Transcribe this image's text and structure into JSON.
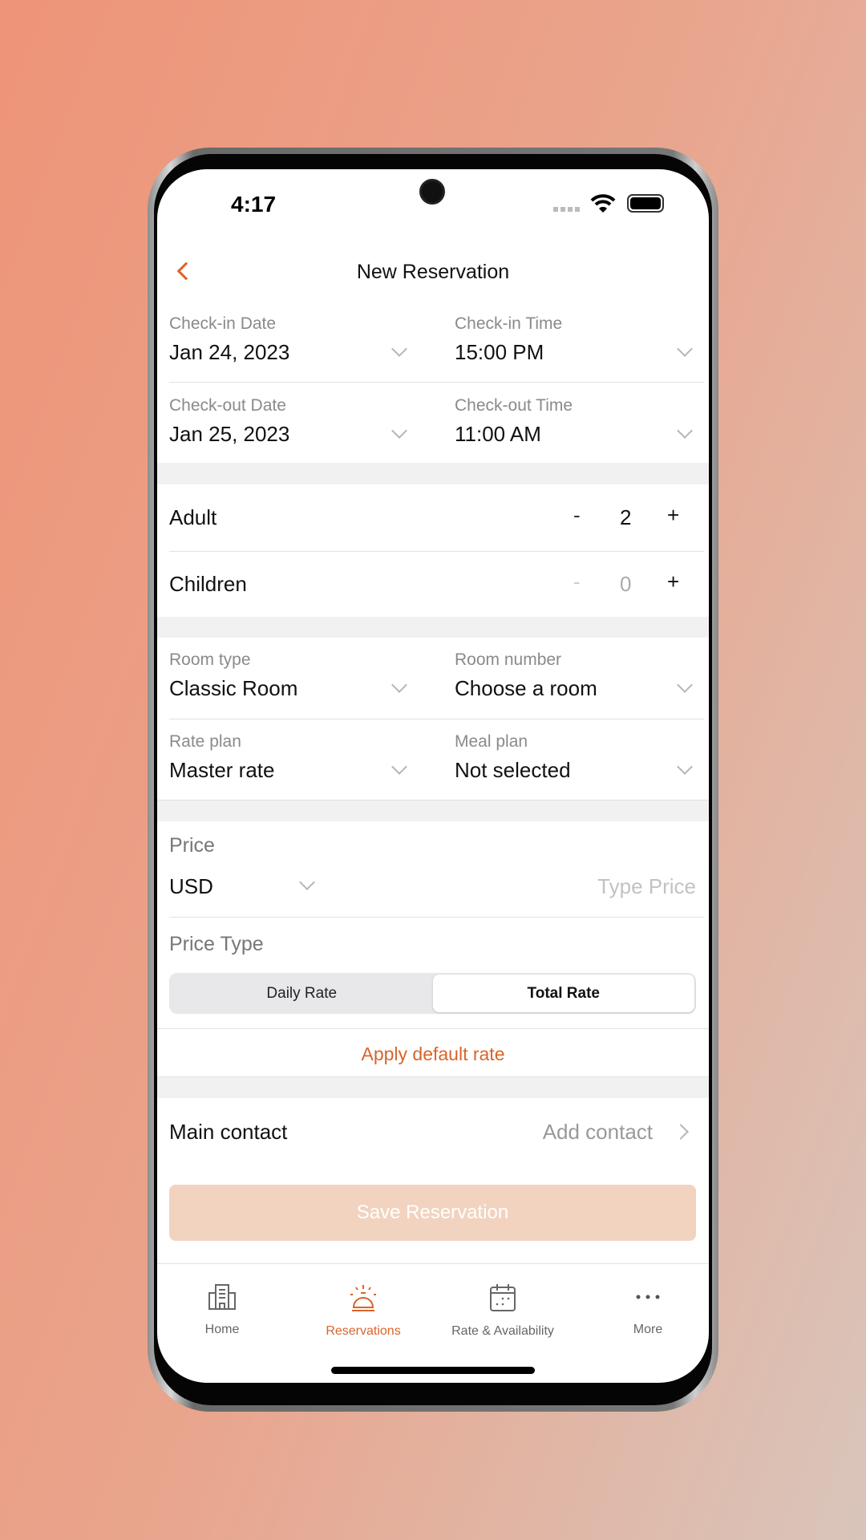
{
  "status_bar": {
    "time": "4:17"
  },
  "header": {
    "title": "New Reservation",
    "back_icon": "chevron-left-icon"
  },
  "dates": {
    "checkin_date_label": "Check-in Date",
    "checkin_date": "Jan 24, 2023",
    "checkin_time_label": "Check-in Time",
    "checkin_time": "15:00 PM",
    "checkout_date_label": "Check-out Date",
    "checkout_date": "Jan 25, 2023",
    "checkout_time_label": "Check-out Time",
    "checkout_time": "11:00 AM"
  },
  "guests": {
    "adult_label": "Adult",
    "adult_count": "2",
    "children_label": "Children",
    "children_count": "0",
    "minus": "-",
    "plus": "+"
  },
  "room": {
    "room_type_label": "Room type",
    "room_type": "Classic Room",
    "room_number_label": "Room number",
    "room_number": "Choose a room",
    "rate_plan_label": "Rate plan",
    "rate_plan": "Master rate",
    "meal_plan_label": "Meal plan",
    "meal_plan": "Not selected"
  },
  "price": {
    "label": "Price",
    "currency": "USD",
    "placeholder": "Type Price",
    "type_label": "Price Type",
    "segments": [
      "Daily Rate",
      "Total Rate"
    ],
    "selected": "Total Rate",
    "apply_default": "Apply default rate"
  },
  "contact": {
    "label": "Main contact",
    "action": "Add contact"
  },
  "save_button": "Save Reservation",
  "tabs": [
    {
      "label": "Home",
      "icon": "building-icon"
    },
    {
      "label": "Reservations",
      "icon": "bell-icon",
      "active": true
    },
    {
      "label": "Rate & Availability",
      "icon": "calendar-icon"
    },
    {
      "label": "More",
      "icon": "more-icon"
    }
  ],
  "colors": {
    "accent": "#d9642a",
    "save_disabled": "#f2d3c0"
  }
}
